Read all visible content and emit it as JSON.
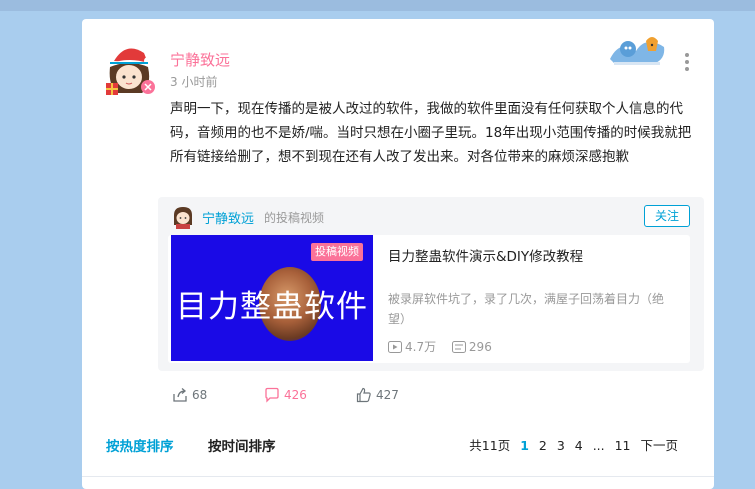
{
  "post": {
    "username": "宁静致远",
    "time": "3 小时前",
    "content": "声明一下，现在传播的是被人改过的软件，我做的软件里面没有任何获取个人信息的代码，音频用的也不是娇/喘。当时只想在小圈子里玩。18年出现小范围传播的时候我就把所有链接给删了，想不到现在还有人改了发出来。对各位带来的麻烦深感抱歉"
  },
  "share": {
    "username": "宁静致远",
    "type_label": "的投稿视频",
    "follow_label": "关注",
    "video": {
      "tag": "投稿视频",
      "thumb_text": "目力整蛊软件",
      "title": "目力整蛊软件演示&DIY修改教程",
      "description": "被录屏软件坑了，录了几次，满屋子回荡着目力（绝望）",
      "plays": "4.7万",
      "danmaku": "296"
    }
  },
  "actions": {
    "share_count": "68",
    "comment_count": "426",
    "like_count": "427"
  },
  "sort_tabs": {
    "hot": "按热度排序",
    "time": "按时间排序"
  },
  "pagination": {
    "total": "共11页",
    "pages": [
      "1",
      "2",
      "3",
      "4",
      "...",
      "11"
    ],
    "next": "下一页"
  },
  "colors": {
    "accent": "#00a1d6",
    "pink": "#fb7299",
    "background": "#a9cdee",
    "thumb_bg": "#1a0ae6"
  }
}
